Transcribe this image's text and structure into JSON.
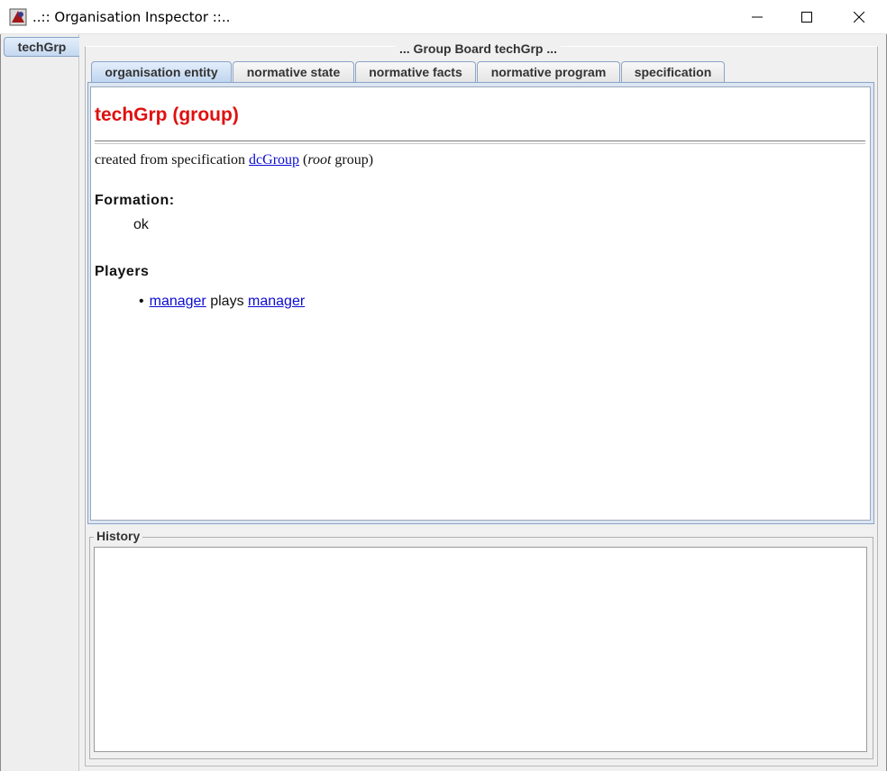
{
  "window": {
    "title": "..:: Organisation Inspector ::.."
  },
  "side_tabs": [
    {
      "label": "techGrp"
    }
  ],
  "board": {
    "title": "... Group Board techGrp ..."
  },
  "tabs": [
    {
      "label": "organisation entity",
      "active": true
    },
    {
      "label": "normative state"
    },
    {
      "label": "normative facts"
    },
    {
      "label": "normative program"
    },
    {
      "label": "specification"
    }
  ],
  "entity": {
    "title": "techGrp (group)",
    "created_prefix": "created from specification",
    "spec_link": "dcGroup",
    "paren_open": "(",
    "root_word": "root",
    "group_word": "group)",
    "formation_heading": "Formation:",
    "formation_value": "ok",
    "players_heading": "Players",
    "players": [
      {
        "agent": "manager",
        "verb": "plays",
        "role": "manager"
      }
    ]
  },
  "history": {
    "title": "History"
  },
  "colors": {
    "title_red": "#e01010",
    "link_blue": "#0b0bd1"
  }
}
